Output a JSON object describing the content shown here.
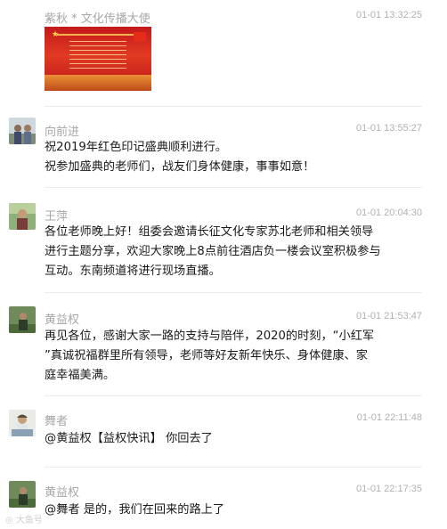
{
  "messages": [
    {
      "name": "紫秋 * 文化传播大使",
      "time": "01-01 13:32:25",
      "text": ""
    },
    {
      "name": "向前进",
      "time": "01-01 13:55:27",
      "text": "祝2019年红色印记盛典顺利进行。\n祝参加盛典的老师们，战友们身体健康，事事如意！"
    },
    {
      "name": "王萍",
      "time": "01-01 20:04:30",
      "text": "各位老师晚上好！组委会邀请长征文化专家苏北老师和相关领导\n进行主题分享，欢迎大家晚上8点前往酒店负一楼会议室积极参与\n互动。东南频道将进行现场直播。"
    },
    {
      "name": "黄益权",
      "time": "01-01 21:53:47",
      "text": "再见各位，感谢大家一路的支持与陪伴，2020的时刻，“小红军\n”真诚祝福群里所有领导，老师等好友新年快乐、身体健康、家\n庭幸福美满。"
    },
    {
      "name": "舞者",
      "time": "01-01 22:11:48",
      "text": "@黄益权【益权快讯】 你回去了"
    },
    {
      "name": "黄益权",
      "time": "01-01 22:17:35",
      "text": "@舞者 是的，我们在回来的路上了"
    }
  ],
  "watermark": "大鱼号",
  "colors": {
    "name": "#a7a7a7",
    "time": "#b2b2b2",
    "text": "#1a1a1a",
    "divider": "#ececec"
  }
}
